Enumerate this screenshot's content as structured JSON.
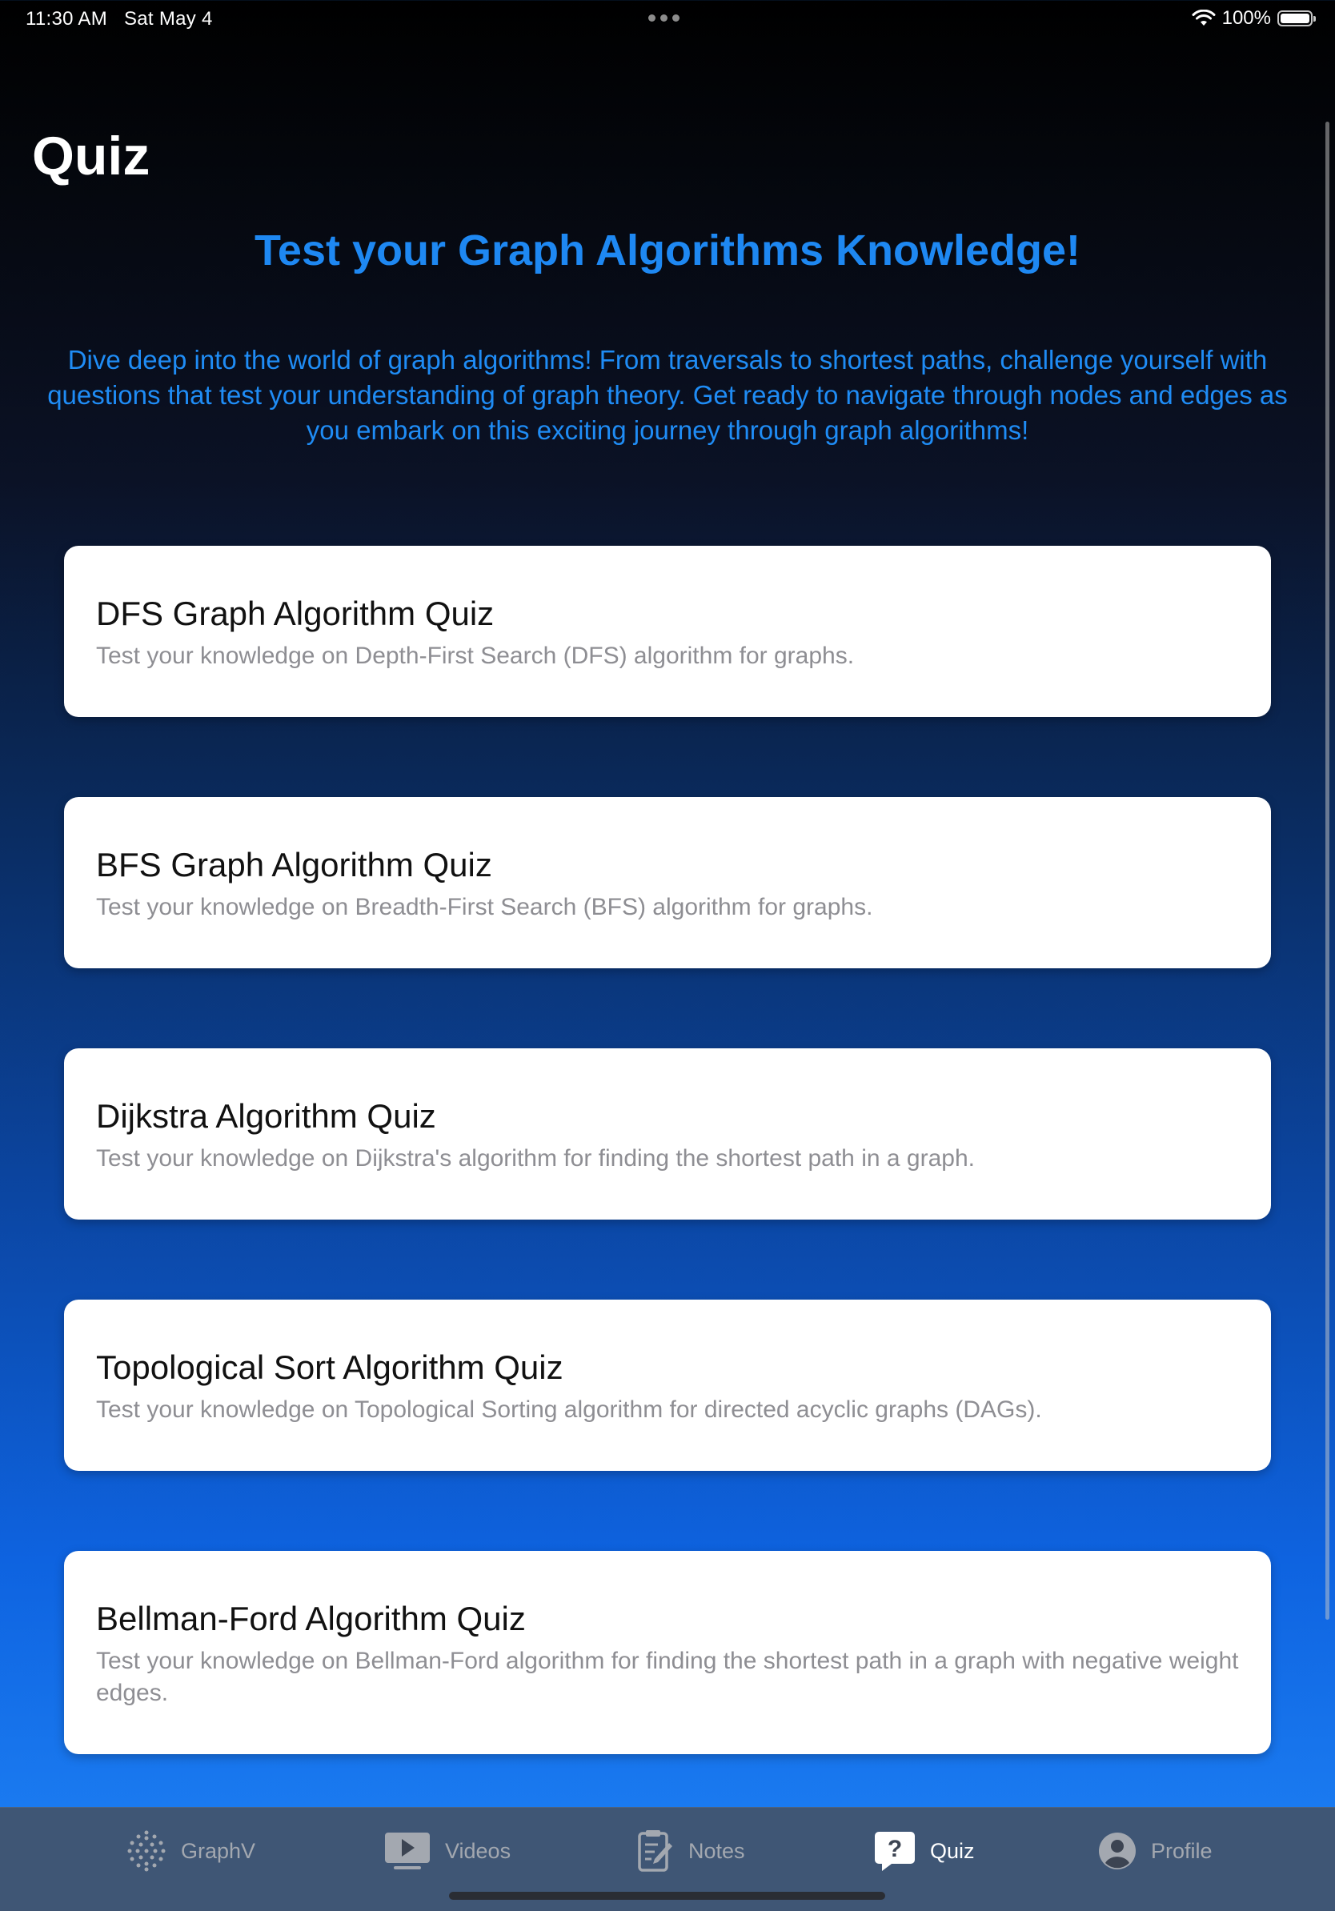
{
  "status": {
    "time": "11:30 AM",
    "date": "Sat May 4",
    "battery_text": "100%"
  },
  "page": {
    "title": "Quiz",
    "headline": "Test your Graph Algorithms Knowledge!",
    "intro": "Dive deep into the world of graph algorithms! From traversals to shortest paths, challenge yourself with questions that test your understanding of graph theory. Get ready to navigate through nodes and edges as you embark on this exciting journey through graph algorithms!"
  },
  "quizzes": [
    {
      "title": "DFS Graph Algorithm Quiz",
      "description": "Test your knowledge on Depth-First Search (DFS) algorithm for graphs."
    },
    {
      "title": "BFS Graph Algorithm Quiz",
      "description": "Test your knowledge on Breadth-First Search (BFS) algorithm for graphs."
    },
    {
      "title": "Dijkstra Algorithm Quiz",
      "description": "Test your knowledge on Dijkstra's algorithm for finding the shortest path in a graph."
    },
    {
      "title": "Topological Sort Algorithm Quiz",
      "description": "Test your knowledge on Topological Sorting algorithm for directed acyclic graphs (DAGs)."
    },
    {
      "title": "Bellman-Ford Algorithm Quiz",
      "description": "Test your knowledge on Bellman-Ford algorithm for finding the shortest path in a graph with negative weight edges."
    }
  ],
  "tabs": [
    {
      "label": "GraphV",
      "icon": "dot-grid-icon",
      "active": false
    },
    {
      "label": "Videos",
      "icon": "play-rectangle-icon",
      "active": false
    },
    {
      "label": "Notes",
      "icon": "note-pencil-icon",
      "active": false
    },
    {
      "label": "Quiz",
      "icon": "question-bubble-icon",
      "active": true
    },
    {
      "label": "Profile",
      "icon": "person-circle-icon",
      "active": false
    }
  ],
  "colors": {
    "accent": "#1e88f2",
    "card_background": "#ffffff",
    "active_tab": "#ffffff",
    "inactive_tab": "#a3a8b0"
  }
}
